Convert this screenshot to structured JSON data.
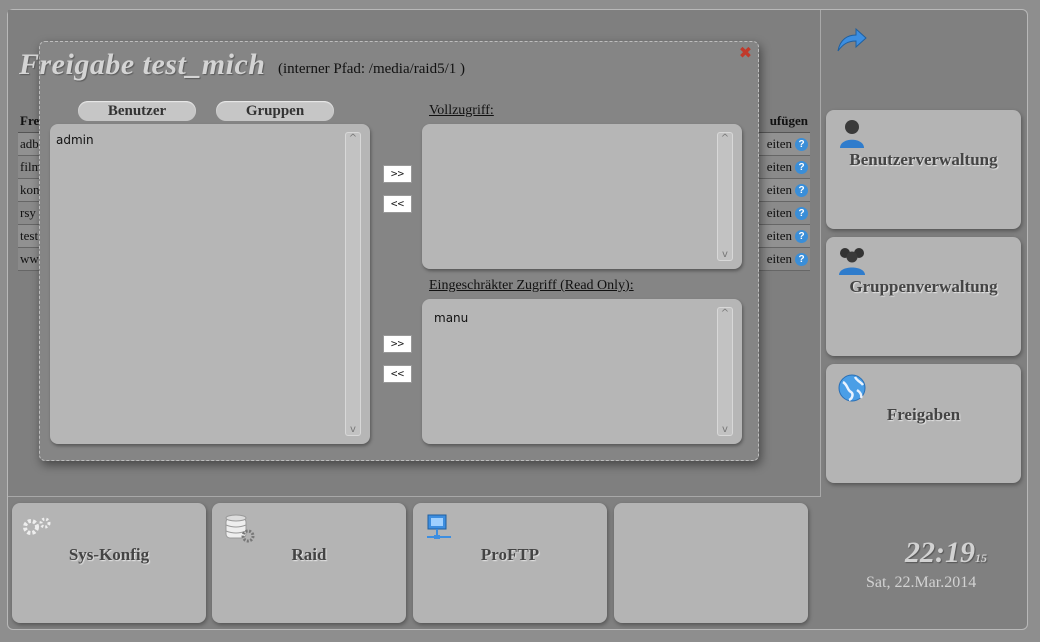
{
  "background_table": {
    "header_left": "Fre",
    "header_right": "ufügen",
    "rows": [
      {
        "left": "adb",
        "right": "eiten"
      },
      {
        "left": "film",
        "right": "eiten"
      },
      {
        "left": "kon",
        "right": "eiten"
      },
      {
        "left": "rsy",
        "right": "eiten"
      },
      {
        "left": "test",
        "right": "eiten"
      },
      {
        "left": "ww",
        "right": "eiten"
      }
    ],
    "help_glyph": "?"
  },
  "dialog": {
    "title": "Freigabe  test_mich",
    "subtitle": "(interner Pfad: /media/raid5/1 )",
    "close_glyph": "✖",
    "tab_users": "Benutzer",
    "tab_groups": "Gruppen",
    "available_list": [
      "admin"
    ],
    "full_access_label": "Vollzugriff:",
    "full_access_list": [],
    "readonly_label": "Eingeschräkter Zugriff (Read Only):",
    "readonly_list": [
      "manu"
    ],
    "add_label": ">>",
    "remove_label": "<<"
  },
  "sidebar": {
    "back_icon": "arrow-back-icon",
    "tiles": [
      {
        "label": "Benutzerverwaltung",
        "icon": "user-icon"
      },
      {
        "label": "Gruppenverwaltung",
        "icon": "group-icon"
      },
      {
        "label": "Freigaben",
        "icon": "globe-icon"
      }
    ]
  },
  "bottom": {
    "tiles": [
      {
        "label": "Sys-Konfig",
        "icon": "gears-icon"
      },
      {
        "label": "Raid",
        "icon": "database-icon"
      },
      {
        "label": "ProFTP",
        "icon": "network-icon"
      },
      {
        "label": ""
      }
    ]
  },
  "clock": {
    "time": "22:19",
    "seconds": "15",
    "date": "Sat, 22.Mar.2014"
  }
}
